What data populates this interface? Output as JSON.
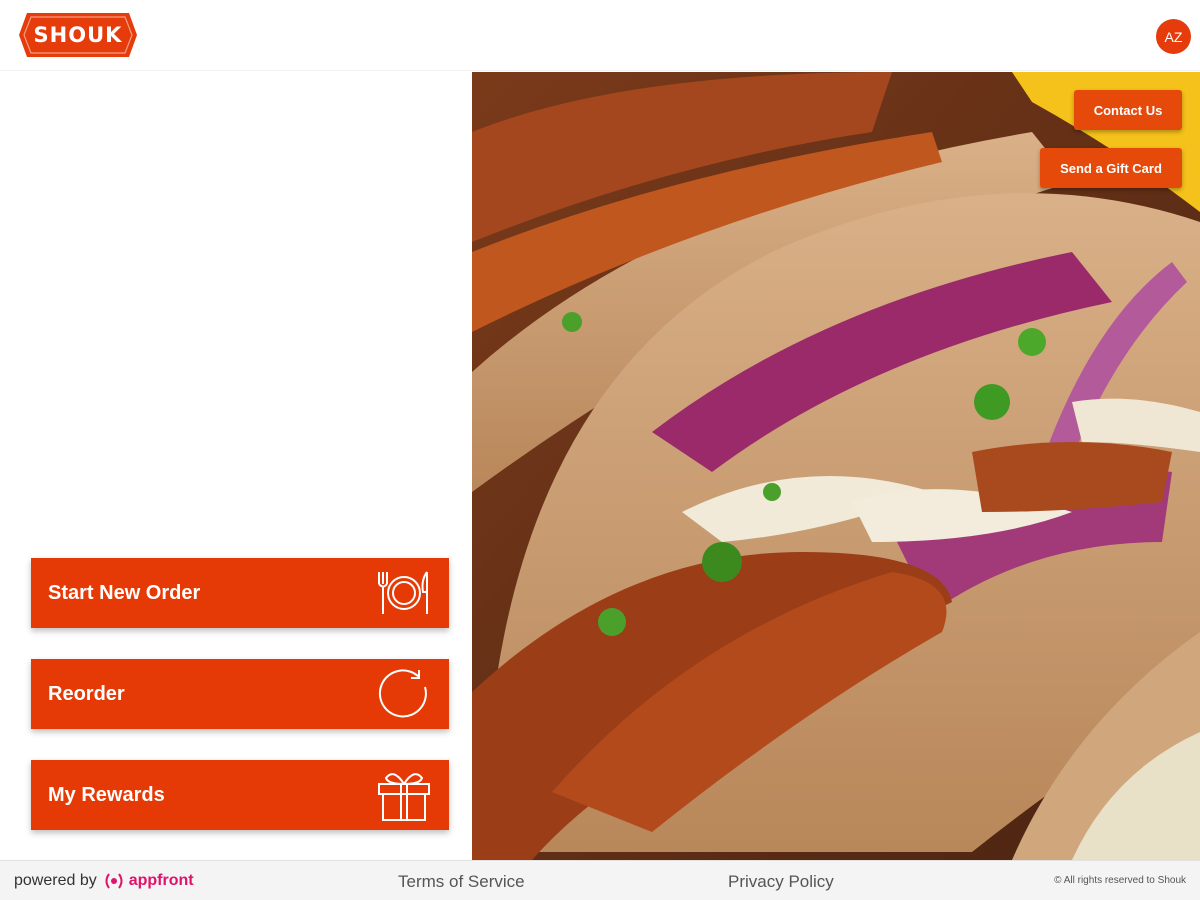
{
  "header": {
    "logo_text": "SHOUK",
    "avatar_initials": "AZ"
  },
  "actions": [
    {
      "label": "Start New Order",
      "icon": "plate-utensils-icon"
    },
    {
      "label": "Reorder",
      "icon": "refresh-icon"
    },
    {
      "label": "My Rewards",
      "icon": "gift-icon"
    }
  ],
  "hero": {
    "contact_label": "Contact Us",
    "gift_card_label": "Send a Gift Card"
  },
  "footer": {
    "powered_by": "powered by",
    "brand": "appfront",
    "terms": "Terms of Service",
    "privacy": "Privacy Policy",
    "copyright": "© All rights reserved to Shouk"
  },
  "colors": {
    "brand_orange": "#e63a06",
    "appfront_pink": "#e0126b"
  }
}
